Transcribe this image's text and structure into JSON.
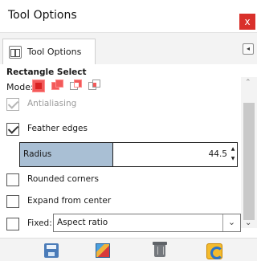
{
  "window": {
    "title": "Tool Options",
    "close_label": "x"
  },
  "tabs": {
    "active_label": "Tool Options",
    "menu_glyph": "◂"
  },
  "tool": {
    "section_title": "Rectangle Select",
    "mode_label": "Mode:",
    "modes": [
      "replace",
      "add",
      "subtract",
      "intersect"
    ],
    "checkboxes": [
      {
        "label": "Antialiasing",
        "checked": true,
        "disabled": true
      },
      {
        "label": "Feather edges",
        "checked": true,
        "disabled": false
      },
      {
        "label": "Rounded corners",
        "checked": false,
        "disabled": false
      },
      {
        "label": "Expand from center",
        "checked": false,
        "disabled": false
      },
      {
        "label": "Fixed:",
        "checked": false,
        "disabled": false
      }
    ],
    "radius": {
      "label": "Radius",
      "value": "44.5"
    },
    "fixed_select": {
      "value": "Aspect ratio"
    }
  },
  "bottom_buttons": [
    "save-icon",
    "restore-icon",
    "delete-icon",
    "reset-icon"
  ],
  "colors": {
    "close": "#d9302b",
    "mode_active": "#f25a5a",
    "radius_fill": "#a9bfd4",
    "panel_bg": "#ffffff",
    "bar_bg": "#f3f3f3"
  }
}
